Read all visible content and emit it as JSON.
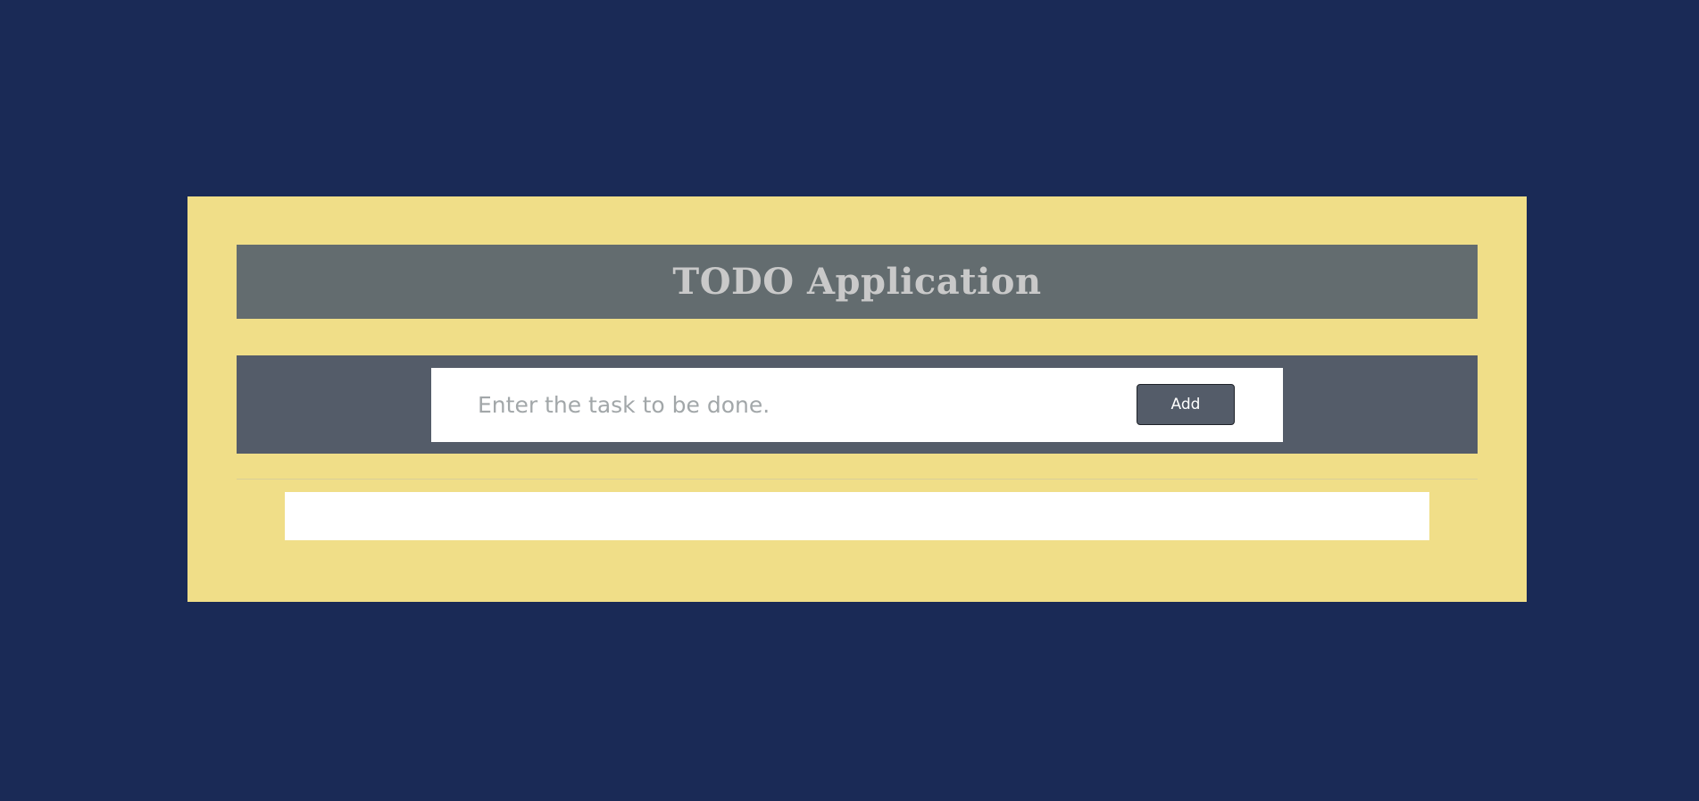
{
  "app": {
    "title": "TODO Application"
  },
  "task_form": {
    "input_value": "",
    "input_placeholder": "Enter the task to be done.",
    "add_label": "Add"
  },
  "task_list": {
    "items": []
  },
  "colors": {
    "page_background": "#1a2a56",
    "card_background": "#f0de88",
    "header_background": "#636c6f",
    "input_bar_background": "#545c69",
    "button_background": "#545c69",
    "title_color": "#c9c9c9"
  }
}
